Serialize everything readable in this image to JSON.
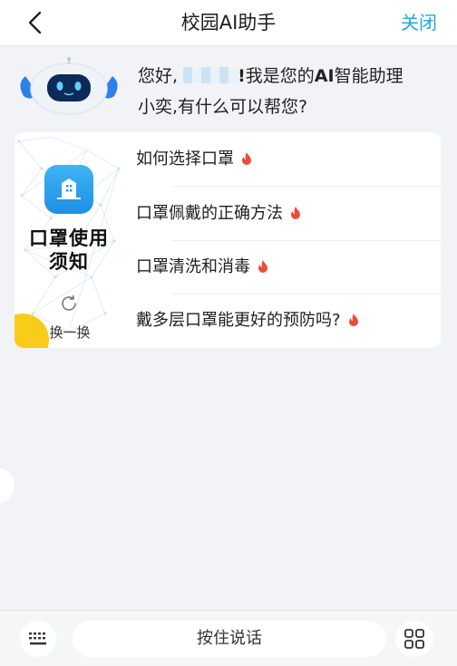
{
  "header": {
    "title": "校园AI助手",
    "close_label": "关闭",
    "back_icon": "chevron-left-icon"
  },
  "greeting": {
    "prefix": "您好,",
    "suffix": "我是您的",
    "strong": "AI",
    "rest_line1": "智能助理",
    "line2": "小奕,有什么可以帮您?",
    "masked_name": true
  },
  "card": {
    "topic_title_line1": "口罩使用",
    "topic_title_line2": "须知",
    "refresh_label": "换一换",
    "questions": [
      {
        "text": "如何选择口罩",
        "hot": true
      },
      {
        "text": "口罩佩戴的正确方法",
        "hot": true
      },
      {
        "text": "口罩清洗和消毒",
        "hot": true
      },
      {
        "text": "戴多层口罩能更好的预防吗?",
        "hot": true
      }
    ]
  },
  "bottom": {
    "hold_to_talk": "按住说话",
    "keyboard_icon": "keyboard-icon",
    "more_icon": "grid-icon"
  },
  "colors": {
    "accent": "#26a5d8",
    "background": "#f1f3f6",
    "hot": "#ee4b3c",
    "deco_yellow": "#f9cc1c"
  }
}
